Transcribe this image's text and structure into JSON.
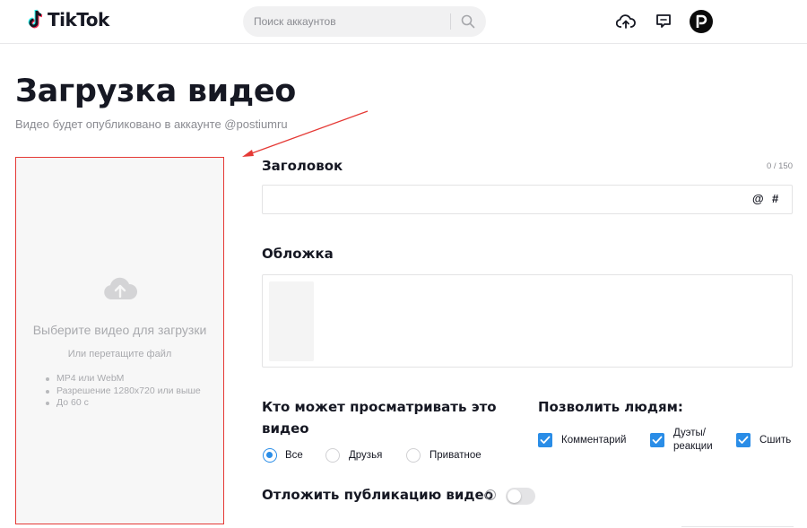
{
  "header": {
    "logo_text": "TikTok",
    "search": {
      "placeholder": "Поиск аккаунтов",
      "icon": "search-icon"
    },
    "icons": [
      "upload-cloud-icon",
      "inbox-icon"
    ],
    "avatar_letter": "P"
  },
  "page": {
    "title": "Загрузка видео",
    "subtitle": "Видео будет опубликовано в аккаунте @postiumru"
  },
  "upload": {
    "title": "Выберите видео для загрузки",
    "hint": "Или перетащите файл",
    "requirements": [
      "MP4 или WebM",
      "Разрешение 1280x720 или выше",
      "До 60 с"
    ],
    "icon": "cloud-upload-icon"
  },
  "form": {
    "caption_label": "Заголовок",
    "caption_count": "0 / 150",
    "caption_value": "",
    "mention_symbol": "@",
    "hashtag_symbol": "#",
    "cover_label": "Обложка",
    "visibility": {
      "label_line1": "Кто может просматривать это",
      "label_line2": "видео",
      "options": [
        {
          "label": "Все",
          "selected": true
        },
        {
          "label": "Друзья",
          "selected": false
        },
        {
          "label": "Приватное",
          "selected": false
        }
      ]
    },
    "allow": {
      "label": "Позволить людям:",
      "options": [
        {
          "label": "Комментарий",
          "checked": true
        },
        {
          "label_line1": "Дуэты/",
          "label_line2": "реакции",
          "checked": true
        },
        {
          "label": "Сшить",
          "checked": true
        }
      ]
    },
    "schedule_label": "Отложить публикацию видео",
    "schedule_enabled": false,
    "info_glyph": "i"
  },
  "colors": {
    "accent": "#2a8de7",
    "annotation_red": "#e53935",
    "upload_bg": "#f7f7f7"
  }
}
